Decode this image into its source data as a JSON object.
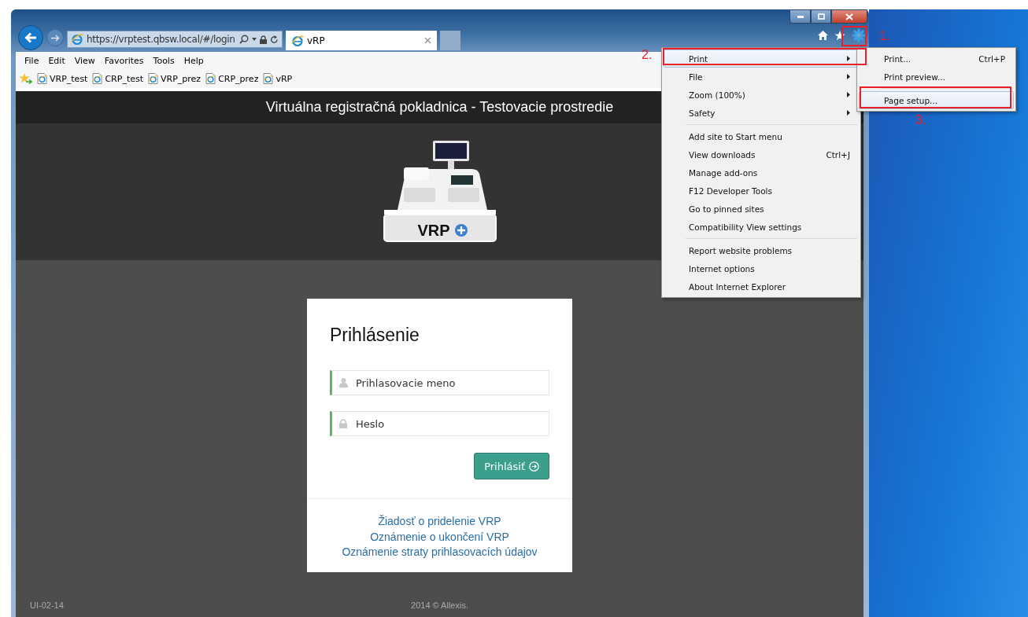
{
  "browser": {
    "address": "https://vrptest.qbsw.local/#/login",
    "tabs": [
      {
        "title": "vRP",
        "selected": true
      }
    ],
    "menu_bar": [
      "File",
      "Edit",
      "View",
      "Favorites",
      "Tools",
      "Help"
    ],
    "favorites": [
      "VRP_test",
      "CRP_test",
      "VRP_prez",
      "CRP_prez",
      "vRP"
    ]
  },
  "page": {
    "header_title": "Virtuálna registračná pokladnica - Testovacie prostredie",
    "logo_text": "VRP",
    "login": {
      "title": "Prihlásenie",
      "username_placeholder": "Prihlasovacie meno",
      "password_placeholder": "Heslo",
      "submit": "Prihlásiť",
      "links": [
        "Žiadosť o pridelenie VRP",
        "Oznámenie o ukončení VRP",
        "Oznámenie straty prihlasovacích údajov"
      ]
    },
    "footer": {
      "code": "UI-02-14",
      "copyright": "2014 © Allexis."
    }
  },
  "tools_menu": {
    "items": [
      {
        "kind": "item",
        "label": "Print",
        "has_submenu": true,
        "highlighted": true
      },
      {
        "kind": "item",
        "label": "File",
        "has_submenu": true,
        "highlighted": false
      },
      {
        "kind": "item",
        "label": "Zoom (100%)",
        "has_submenu": true,
        "highlighted": false
      },
      {
        "kind": "item",
        "label": "Safety",
        "has_submenu": true,
        "highlighted": false
      },
      {
        "kind": "separator"
      },
      {
        "kind": "item",
        "label": "Add site to Start menu",
        "has_submenu": false,
        "highlighted": false
      },
      {
        "kind": "item",
        "label": "View downloads",
        "shortcut": "Ctrl+J",
        "has_submenu": false,
        "highlighted": false
      },
      {
        "kind": "item",
        "label": "Manage add-ons",
        "has_submenu": false,
        "highlighted": false
      },
      {
        "kind": "item",
        "label": "F12 Developer Tools",
        "has_submenu": false,
        "highlighted": false
      },
      {
        "kind": "item",
        "label": "Go to pinned sites",
        "has_submenu": false,
        "highlighted": false
      },
      {
        "kind": "item",
        "label": "Compatibility View settings",
        "has_submenu": false,
        "highlighted": false
      },
      {
        "kind": "separator"
      },
      {
        "kind": "item",
        "label": "Report website problems",
        "has_submenu": false,
        "highlighted": false
      },
      {
        "kind": "item",
        "label": "Internet options",
        "has_submenu": false,
        "highlighted": false
      },
      {
        "kind": "item",
        "label": "About Internet Explorer",
        "has_submenu": false,
        "highlighted": false
      }
    ]
  },
  "print_submenu": {
    "items": [
      {
        "kind": "item",
        "label": "Print...",
        "shortcut": "Ctrl+P",
        "has_submenu": false,
        "highlighted": false
      },
      {
        "kind": "item",
        "label": "Print preview...",
        "has_submenu": false,
        "highlighted": false
      },
      {
        "kind": "separator"
      },
      {
        "kind": "item",
        "label": "Page setup...",
        "has_submenu": false,
        "highlighted": true
      }
    ]
  },
  "annotations": [
    "1.",
    "2.",
    "3."
  ]
}
